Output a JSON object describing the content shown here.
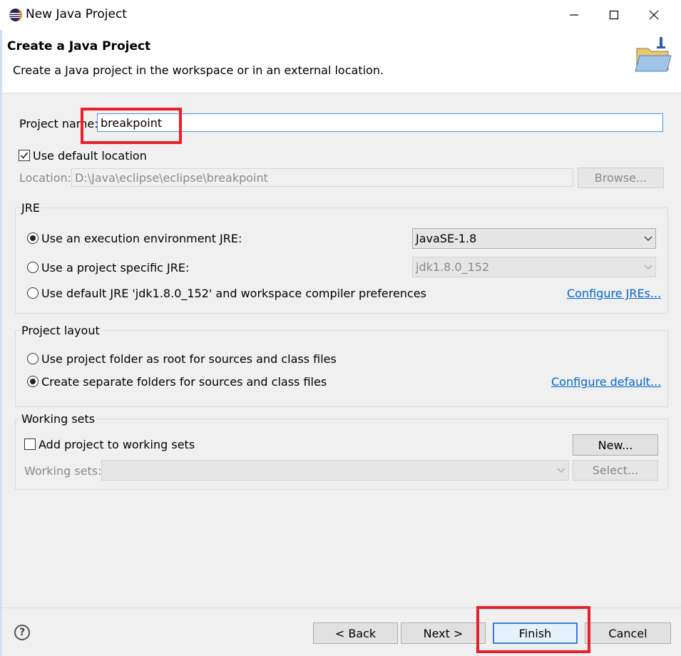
{
  "window": {
    "title": "New Java Project"
  },
  "banner": {
    "title": "Create a Java Project",
    "description": "Create a Java project in the workspace or in an external location."
  },
  "project": {
    "name_label": "Project name:",
    "name_value": "breakpoint",
    "use_default_location_label": "Use default location",
    "use_default_location_checked": true,
    "location_label": "Location:",
    "location_value": "D:\\Java\\eclipse\\eclipse\\breakpoint",
    "browse_label": "Browse..."
  },
  "jre": {
    "group_title": "JRE",
    "exec_env_label": "Use an execution environment JRE:",
    "exec_env_selected": "JavaSE-1.8",
    "specific_label": "Use a project specific JRE:",
    "specific_selected": "jdk1.8.0_152",
    "default_label": "Use default JRE 'jdk1.8.0_152' and workspace compiler preferences",
    "configure_link": "Configure JREs..."
  },
  "layout": {
    "group_title": "Project layout",
    "root_label": "Use project folder as root for sources and class files",
    "separate_label": "Create separate folders for sources and class files",
    "configure_link": "Configure default..."
  },
  "working_sets": {
    "group_title": "Working sets",
    "add_label": "Add project to working sets",
    "new_label": "New...",
    "sets_label": "Working sets:",
    "select_label": "Select..."
  },
  "footer": {
    "help_symbol": "?",
    "back_label": "< Back",
    "next_label": "Next >",
    "finish_label": "Finish",
    "cancel_label": "Cancel"
  },
  "colors": {
    "highlight": "#e8202a",
    "link": "#0066cc",
    "focus": "#3c7fd1"
  }
}
